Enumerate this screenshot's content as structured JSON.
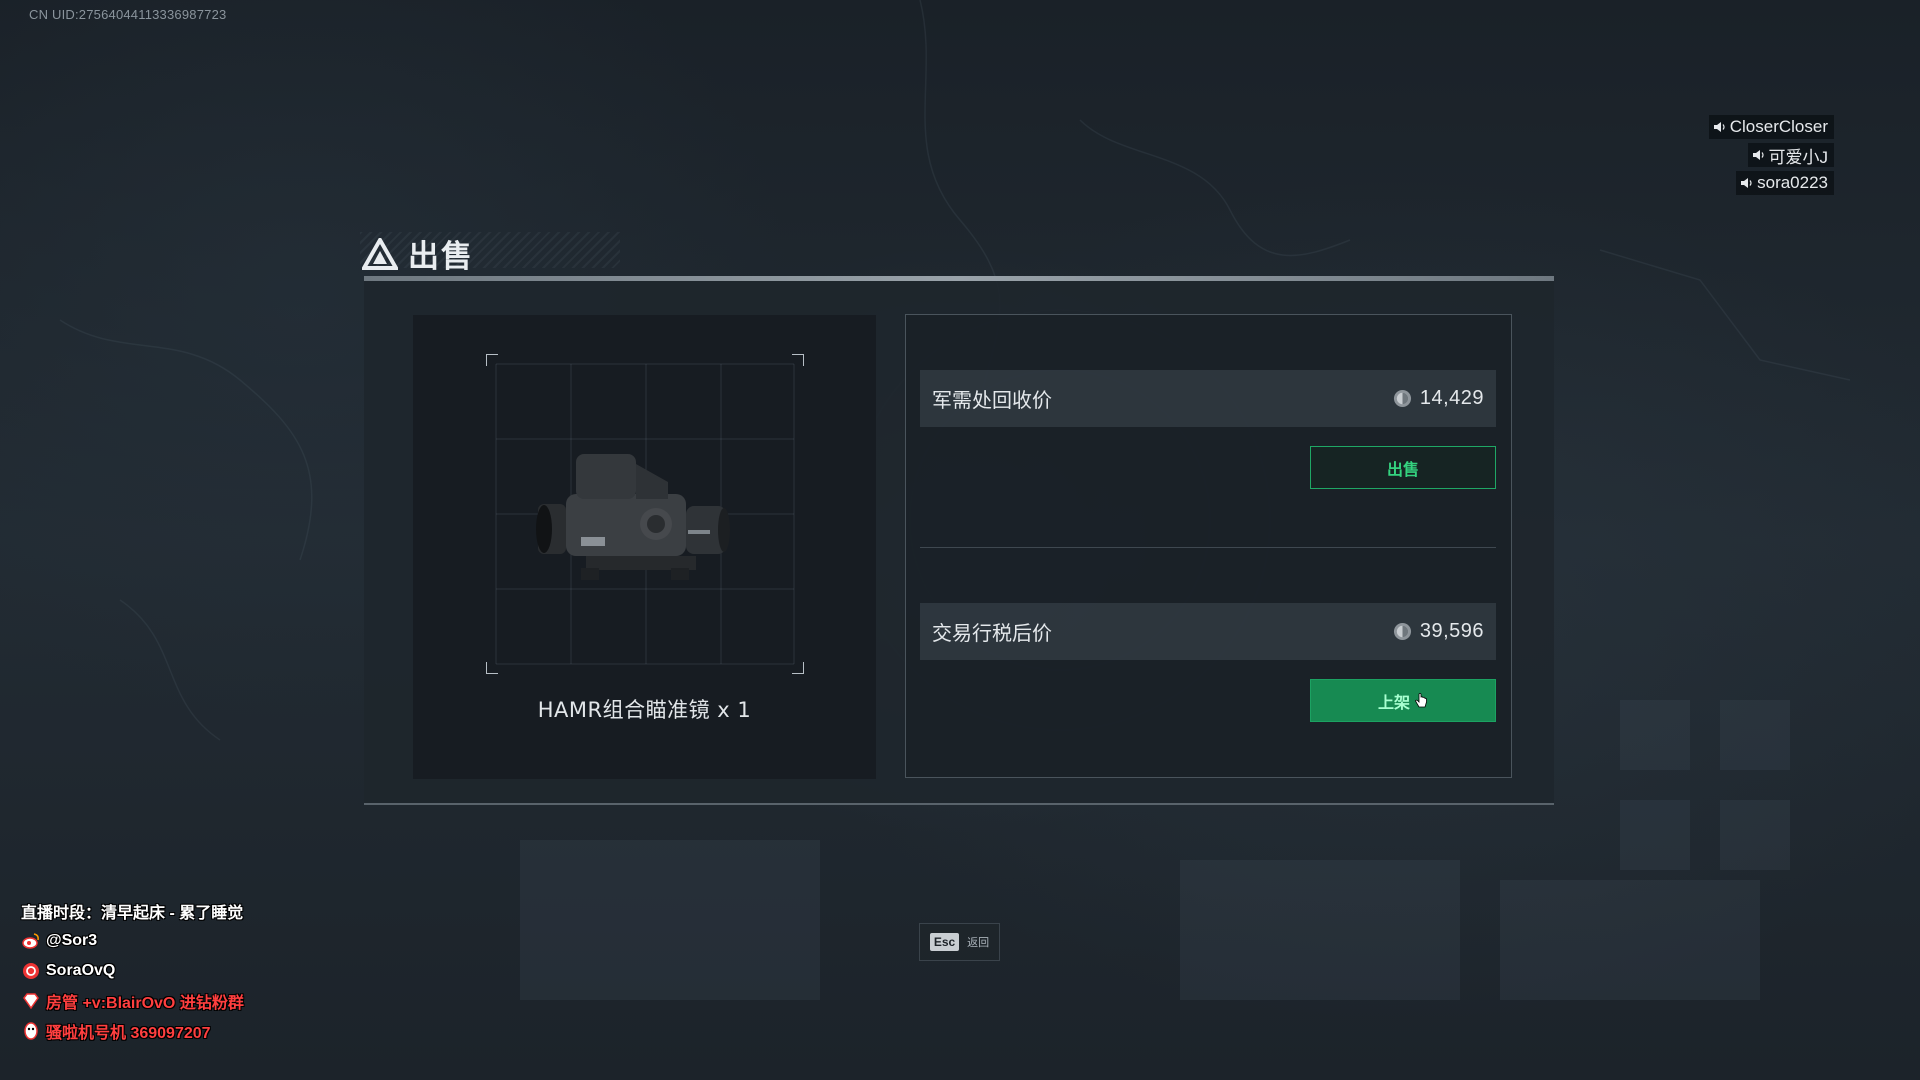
{
  "uid_text": "CN UID:27564044113336987723",
  "voice_users": [
    "CloserCloser",
    "可爱小J",
    "sora0223"
  ],
  "dialog": {
    "title": "出售",
    "item": {
      "name": "HAMR组合瞄准镜 x 1",
      "image_icon": "scope-icon"
    },
    "recycle": {
      "label": "军需处回收价",
      "value": "14,429",
      "button_label": "出售"
    },
    "market": {
      "label": "交易行税后价",
      "value": "39,596",
      "button_label": "上架"
    },
    "esc": {
      "key": "Esc",
      "label": "返回"
    }
  },
  "stream_overlay": {
    "schedule": "直播时段：清早起床 - 累了睡觉",
    "weibo": "@Sor3",
    "douyin": "SoraOvQ",
    "group": "房管 +v:BlairOvO 进钻粉群",
    "qq": "骚啦机号机 369097207"
  },
  "colors": {
    "accent_green": "#1fa765",
    "background": "#1b2229"
  }
}
